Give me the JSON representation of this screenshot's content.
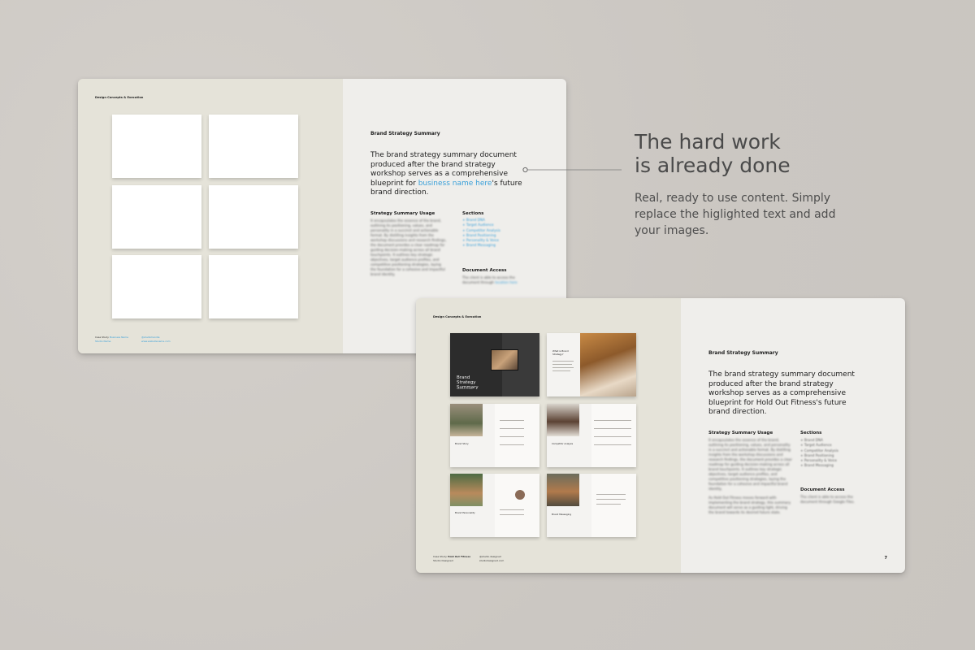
{
  "back_spread": {
    "header": "Design Concepts & Execution",
    "footer": {
      "case_study_prefix": "Case Study",
      "case_study_name": "Business Name",
      "studio": "Studio Name",
      "handle": "@studiohandle",
      "site": "www.websitename.com"
    },
    "right": {
      "subtitle": "Brand Strategy Summary",
      "lead_before": "The brand strategy summary document produced after the brand strategy workshop serves as a comprehensive blueprint for ",
      "lead_highlight": "business name here",
      "lead_after": "'s future brand direction.",
      "usage_heading": "Strategy Summary Usage",
      "usage_body": "It encapsulates the essence of the brand, outlining its positioning, values, and personality in a succinct and actionable format. By distilling insights from the workshop discussions and research findings, the document provides a clear roadmap for guiding decision-making across all brand touchpoints. It outlines key strategic objectives, target audience profiles, and competitive positioning strategies, laying the foundation for a cohesive and impactful brand identity.",
      "sections_heading": "Sections",
      "sections": [
        "+ Brand DNA",
        "+ Target Audience",
        "+ Competitor Analysis",
        "+ Brand Positioning",
        "+ Personality & Voice",
        "+ Brand Messaging"
      ],
      "access_heading": "Document Access",
      "access_body": "The client is able to access the document through ",
      "access_link": "location here"
    }
  },
  "front_spread": {
    "header": "Design Concepts & Execution",
    "footer": {
      "case_study_prefix": "Case Study",
      "case_study_name": "Hold Out Fitness",
      "studio": "Studio Designed",
      "handle": "@studio.designed",
      "site": "studiodesigned.com"
    },
    "page_number": "7",
    "thumbnails": {
      "cover_title": "Brand Strategy Summary",
      "cover_small": "Hold Out Fitness",
      "brand_strategy_label": "What is Brand Strategy?",
      "brand_story_label": "Brand Story",
      "competitor_label": "Competitor Analysis",
      "personality_label": "Brand Personality",
      "messaging_label": "Brand Messaging"
    },
    "right": {
      "subtitle": "Brand Strategy Summary",
      "lead": "The brand strategy summary document produced after the brand strategy workshop serves as a comprehensive blueprint for Hold Out Fitness's future brand direction.",
      "usage_heading": "Strategy Summary Usage",
      "usage_body": "It encapsulates the essence of the brand, outlining its positioning, values, and personality in a succinct and actionable format. By distilling insights from the workshop discussions and research findings, the document provides a clear roadmap for guiding decision-making across all brand touchpoints. It outlines key strategic objectives, target audience profiles, and competitive positioning strategies, laying the foundation for a cohesive and impactful brand identity.",
      "usage_body_2": "As Hold Out Fitness moves forward with implementing the brand strategy, this summary document will serve as a guiding light, driving the brand towards its desired future state.",
      "sections_heading": "Sections",
      "sections": [
        "+ Brand DNA",
        "+ Target Audience",
        "+ Competitor Analysis",
        "+ Brand Positioning",
        "+ Personality & Voice",
        "+ Brand Messaging"
      ],
      "access_heading": "Document Access",
      "access_body": "The client is able to access the document through Google Files."
    }
  },
  "promo": {
    "headline_line1": "The hard work",
    "headline_line2": "is already done",
    "subcopy": "Real, ready to use content. Simply replace the higlighted text and add your images."
  },
  "colors": {
    "background": "#cfcbc6",
    "left_page": "#e5e3d9",
    "right_page": "#efeeeb",
    "accent": "#3aa0d9",
    "headline": "#4a4a4a"
  }
}
